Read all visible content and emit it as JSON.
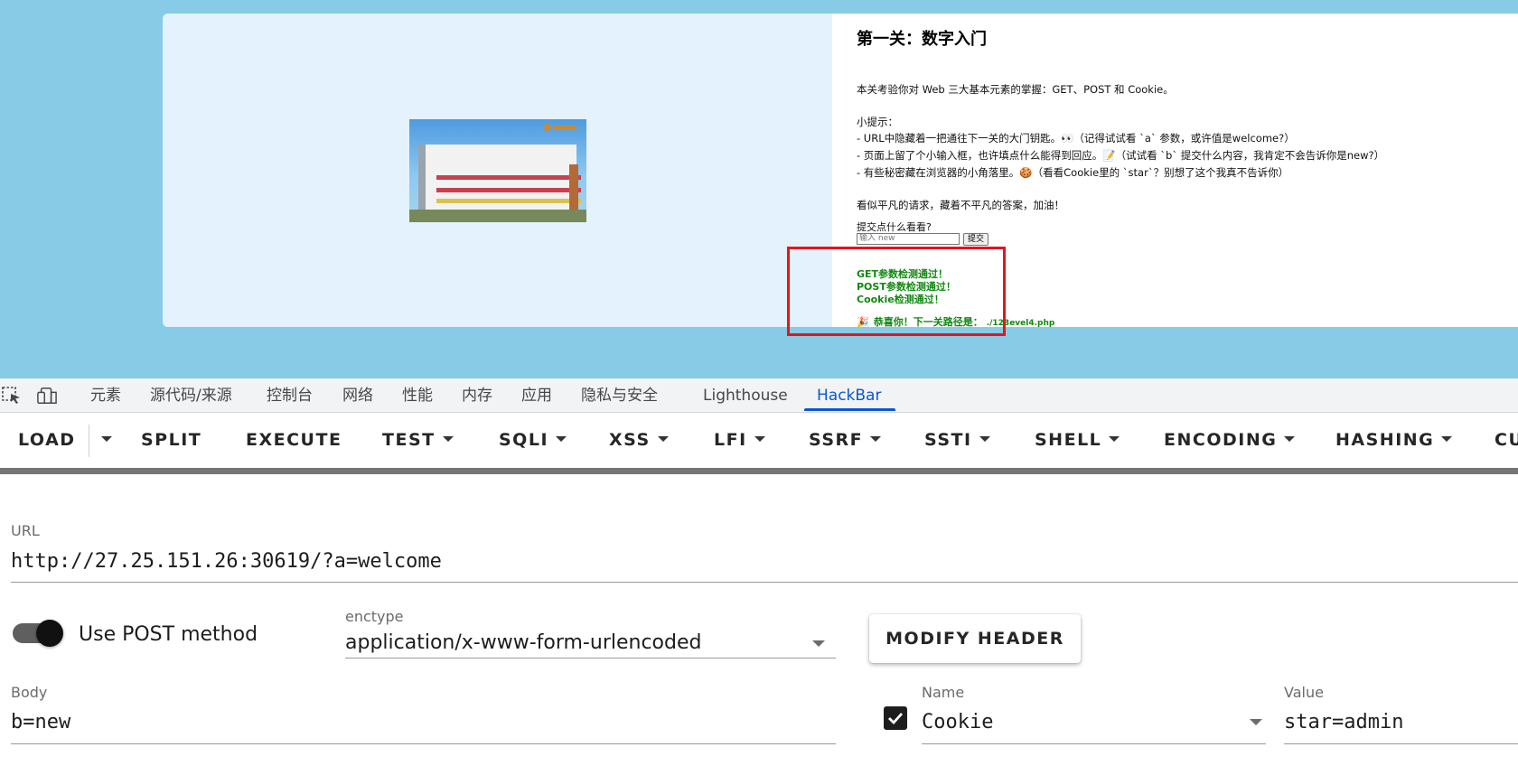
{
  "page": {
    "title": "第一关：数字入门",
    "intro": "本关考验你对 Web 三大基本元素的掌握：GET、POST 和 Cookie。",
    "tips_heading": "小提示：",
    "tips": [
      "- URL中隐藏着一把通往下一关的大门钥匙。👀（记得试试看 `a` 参数，或许值是welcome?）",
      "- 页面上留了个小输入框，也许填点什么能得到回应。📝（试试看 `b` 提交什么内容，我肯定不会告诉你是new?）",
      "- 有些秘密藏在浏览器的小角落里。🍪（看看Cookie里的 `star`？别想了这个我真不告诉你）"
    ],
    "encourage": "看似平凡的请求，藏着不平凡的答案，加油！",
    "submit_label": "提交点什么看看?",
    "input_placeholder": "输入 new",
    "submit_button": "提交",
    "results": [
      "GET参数检测通过！",
      "POST参数检测通过！",
      "Cookie检测通过！"
    ],
    "success_icon": "🎉",
    "success_text": "恭喜你！下一关路径是：",
    "success_path": "./123evel4.php",
    "image_logo": "logo-mark",
    "highlight_color": "#e8141b"
  },
  "devtools": {
    "tabs": [
      "元素",
      "源代码/来源",
      "控制台",
      "网络",
      "性能",
      "内存",
      "应用",
      "隐私与安全",
      "Lighthouse",
      "HackBar"
    ],
    "active_tab": "HackBar",
    "icons": [
      "inspect-element-icon",
      "device-toolbar-icon"
    ]
  },
  "hackbar": {
    "toolbar": [
      "LOAD",
      "SPLIT",
      "EXECUTE",
      "TEST",
      "SQLI",
      "XSS",
      "LFI",
      "SSRF",
      "SSTI",
      "SHELL",
      "ENCODING",
      "HASHING",
      "CU"
    ],
    "url_label": "URL",
    "url_value": "http://27.25.151.26:30619/?a=welcome",
    "post_toggle_label": "Use POST method",
    "post_enabled": true,
    "enctype_label": "enctype",
    "enctype_value": "application/x-www-form-urlencoded",
    "modify_header_label": "MODIFY HEADER",
    "body_label": "Body",
    "body_value": "b=new",
    "header_enabled": true,
    "header_name_label": "Name",
    "header_name_value": "Cookie",
    "header_value_label": "Value",
    "header_value_value": "star=admin"
  }
}
